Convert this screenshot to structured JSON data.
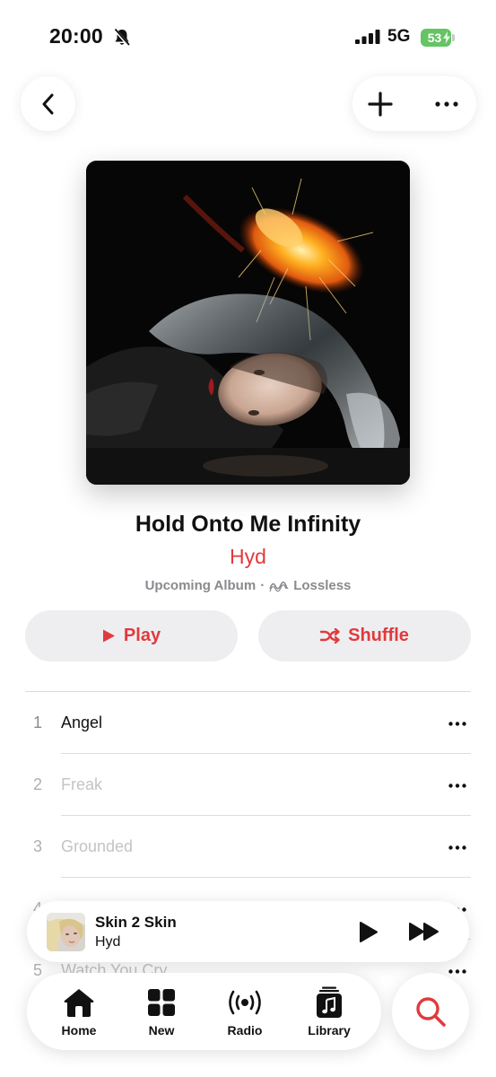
{
  "status_bar": {
    "time": "20:00",
    "network": "5G",
    "battery": "53",
    "icons": [
      "bell-slash-icon",
      "signal-icon",
      "battery-charging-icon"
    ]
  },
  "nav": {
    "back_icon": "chevron-left-icon",
    "add_icon": "plus-icon",
    "more_icon": "ellipsis-icon"
  },
  "album": {
    "title": "Hold Onto Me Infinity",
    "artist": "Hyd",
    "status": "Upcoming Album",
    "separator": "·",
    "quality": "Lossless",
    "quality_icon": "lossless-waveform-icon"
  },
  "actions": {
    "play_label": "Play",
    "shuffle_label": "Shuffle"
  },
  "tracks": [
    {
      "number": "1",
      "title": "Angel",
      "available": true
    },
    {
      "number": "2",
      "title": "Freak",
      "available": false
    },
    {
      "number": "3",
      "title": "Grounded",
      "available": false
    },
    {
      "number": "4",
      "title": "",
      "available": false
    },
    {
      "number": "5",
      "title": "Watch You Cry",
      "available": false
    }
  ],
  "now_playing": {
    "title": "Skin 2 Skin",
    "artist": "Hyd"
  },
  "tab_bar": {
    "tabs": [
      {
        "label": "Home",
        "icon": "home-icon"
      },
      {
        "label": "New",
        "icon": "grid-icon"
      },
      {
        "label": "Radio",
        "icon": "radio-waves-icon"
      },
      {
        "label": "Library",
        "icon": "music-library-icon"
      }
    ],
    "search_icon": "search-icon"
  },
  "colors": {
    "accent": "#e03a3e",
    "battery": "#65c466",
    "secondary_text": "#8a8a8e",
    "button_bg": "#eeeef0"
  }
}
